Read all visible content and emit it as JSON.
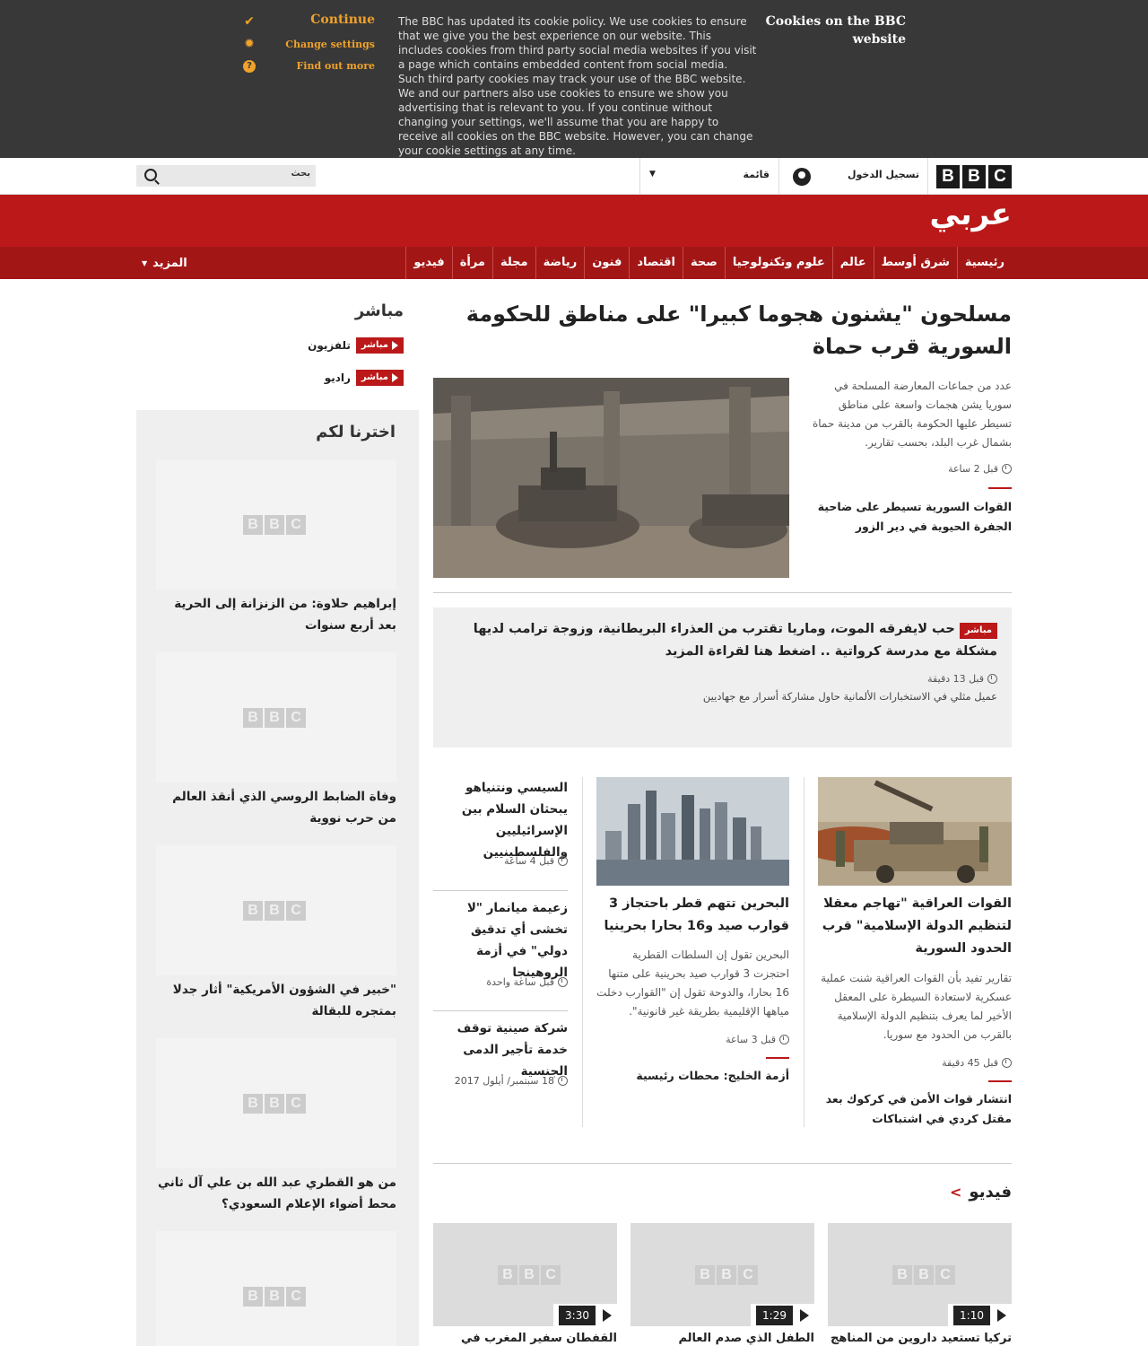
{
  "cookie": {
    "heading": "Cookies on the BBC website",
    "body": "The BBC has updated its cookie policy. We use cookies to ensure that we give you the best experience on our website. This includes cookies from third party social media websites if you visit a page which contains embedded content from social media. Such third party cookies may track your use of the BBC website. We and our partners also use cookies to ensure we show you advertising that is relevant to you. If you continue without changing your settings, we'll assume that you are happy to receive all cookies on the BBC website. However, you can change your cookie settings at any time.",
    "continue": "Continue",
    "change_settings": "Change settings",
    "find_out_more": "Find out more"
  },
  "topbar": {
    "logo": [
      "B",
      "B",
      "C"
    ],
    "signin": "تسجيل الدخول",
    "menu": "قائمة",
    "search_placeholder": "بحث"
  },
  "masthead": {
    "brand": "عربي"
  },
  "nav": {
    "items": [
      "رئيسية",
      "شرق أوسط",
      "عالم",
      "علوم وتكنولوجيا",
      "صحة",
      "اقتصاد",
      "فنون",
      "رياضة",
      "مجلة",
      "مرأة",
      "فيديو"
    ],
    "more": "المزيد"
  },
  "lead": {
    "headline": "مسلحون \"يشنون هجوما كبيرا\" على مناطق للحكومة السورية قرب حماة",
    "summary": "عدد من جماعات المعارضة المسلحة في سوريا يشن هجمات واسعة على مناطق تسيطر عليها الحكومة بالقرب من مدينة حماة بشمال غرب البلد، بحسب تقارير.",
    "time": "قبل 2 ساعة",
    "related": "القوات السورية تسيطر على ضاحية الجفرة الحيوية في دير الزور"
  },
  "live_box": {
    "badge": "مباشر",
    "headline": "حب لايفرقه الموت، وماريا تقترب من العذراء البريطانية، وزوجة ترامب لديها مشكلة مع مدرسة كرواتية .. اضغط هنا لقراءة المزيد",
    "time": "قبل 13 دقيقة",
    "sub": "عميل مثلي في الاستخبارات الألمانية حاول مشاركة أسرار مع جهاديين"
  },
  "story_iraq": {
    "headline": "القوات العراقية \"تهاجم معقلا لتنظيم الدولة الإسلامية\" قرب الحدود السورية",
    "summary": "تقارير تفيد بأن القوات العراقية شنت عملية عسكرية لاستعادة السيطرة على المعقل الأخير لما يعرف بتنظيم الدولة الإسلامية بالقرب من الحدود مع سوريا.",
    "time": "قبل 45 دقيقة",
    "related": "انتشار قوات الأمن في كركوك بعد مقتل كردي في اشتباكات"
  },
  "story_bahrain": {
    "headline": "البحرين تتهم قطر باحتجاز 3 قوارب صيد و16 بحارا بحرينيا",
    "summary": "البحرين تقول إن السلطات القطرية احتجزت 3 قوارب صيد بحرينية على متنها 16 بحارا، والدوحة تقول إن \"القوارب دخلت مياهها الإقليمية بطريقة غير قانونية\".",
    "time": "قبل 3 ساعة",
    "related": "أزمة الخليج: محطات رئيسية"
  },
  "side_stories": [
    {
      "headline": "السيسي ونتنياهو يبحثان السلام بين الإسرائيليين والفلسطينيين",
      "time": "قبل 4 ساعة"
    },
    {
      "headline": "زعيمة ميانمار \"لا تخشى أي تدقيق دولي\" في أزمة الروهينجا",
      "time": "قبل ساعة واحدة"
    },
    {
      "headline": "شركة صينية توقف خدمة تأجير الدمى الجنسية",
      "time": "18 سبتمبر/ أيلول 2017"
    }
  ],
  "live": {
    "title": "مباشر",
    "badge": "مباشر",
    "tv": "تلفزيون",
    "radio": "راديو"
  },
  "picks": {
    "title": "اخترنا لكم",
    "items": [
      "إبراهيم حلاوة: من الزنزانة إلى الحرية بعد أربع سنوات",
      "وفاة الضابط الروسي الذي أنقذ العالم من حرب نووية",
      "\"خبير في الشؤون الأمريكية\" أثار جدلا بمتجره للبقالة",
      "من هو القطري عبد الله بن علي آل ثاني محط أضواء الإعلام السعودي؟"
    ]
  },
  "video": {
    "title": "فيديو",
    "items": [
      {
        "duration": "1:10",
        "headline": "تركيا تستعيد داروين من المناهج"
      },
      {
        "duration": "1:29",
        "headline": "الطفل الذي صدم العالم"
      },
      {
        "duration": "3:30",
        "headline": "القفطان سفير المغرب في لندن"
      }
    ]
  },
  "colors": {
    "brand_red": "#bb1919",
    "nav_red": "#a31616",
    "cookie_bg": "#383838",
    "cookie_accent": "#f0a22b"
  }
}
